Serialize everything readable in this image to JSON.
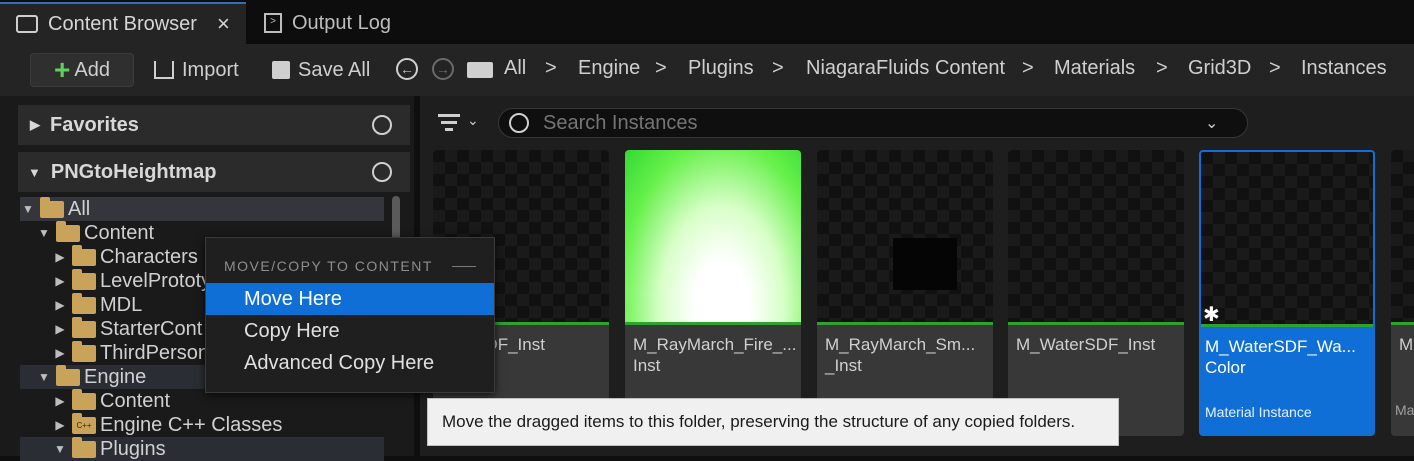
{
  "tabs": [
    {
      "label": "Content Browser",
      "close": "×",
      "active": true
    },
    {
      "label": "Output Log",
      "active": false
    }
  ],
  "toolbar": {
    "add_label": "Add",
    "import_label": "Import",
    "save_all_label": "Save All"
  },
  "breadcrumb": [
    "All",
    "Engine",
    "Plugins",
    "NiagaraFluids Content",
    "Materials",
    "Grid3D",
    "Instances"
  ],
  "breadcrumb_separator": ">",
  "left": {
    "favorites": "Favorites",
    "project": "PNGtoHeightmap",
    "tree": [
      {
        "label": "All",
        "depth": 0,
        "expanded": true,
        "selected": true
      },
      {
        "label": "Content",
        "depth": 1,
        "expanded": true
      },
      {
        "label": "Characters",
        "depth": 2
      },
      {
        "label": "LevelPrototy",
        "depth": 2
      },
      {
        "label": "MDL",
        "depth": 2
      },
      {
        "label": "StarterCont",
        "depth": 2
      },
      {
        "label": "ThirdPerson",
        "depth": 2
      },
      {
        "label": "Engine",
        "depth": 1,
        "expanded": true,
        "highlight": true
      },
      {
        "label": "Content",
        "depth": 2
      },
      {
        "label": "Engine C++ Classes",
        "depth": 2,
        "cpp": true
      },
      {
        "label": "Plugins",
        "depth": 2,
        "expanded": true,
        "highlight": true
      }
    ]
  },
  "search": {
    "placeholder": "Search Instances"
  },
  "assets": [
    {
      "name": "...ugSDF_Inst",
      "name2": ""
    },
    {
      "name": "M_RayMarch_Fire_...",
      "name2": "Inst"
    },
    {
      "name": "M_RayMarch_Sm...",
      "name2": "_Inst"
    },
    {
      "name": "M_WaterSDF_Inst",
      "name2": ""
    },
    {
      "name": "M_WaterSDF_Wa...",
      "name2": "Color",
      "type": "Material Instance",
      "selected": true
    },
    {
      "name": "M",
      "name2": "",
      "type": "Ma"
    }
  ],
  "menu": {
    "header": "MOVE/COPY TO CONTENT",
    "items": [
      "Move Here",
      "Copy Here",
      "Advanced Copy Here"
    ]
  },
  "tooltip": "Move the dragged items to this folder, preserving the structure of any copied folders.",
  "colors": {
    "accent": "#0f6fd6",
    "folder": "#c9a35a",
    "green": "#2ea12e"
  }
}
